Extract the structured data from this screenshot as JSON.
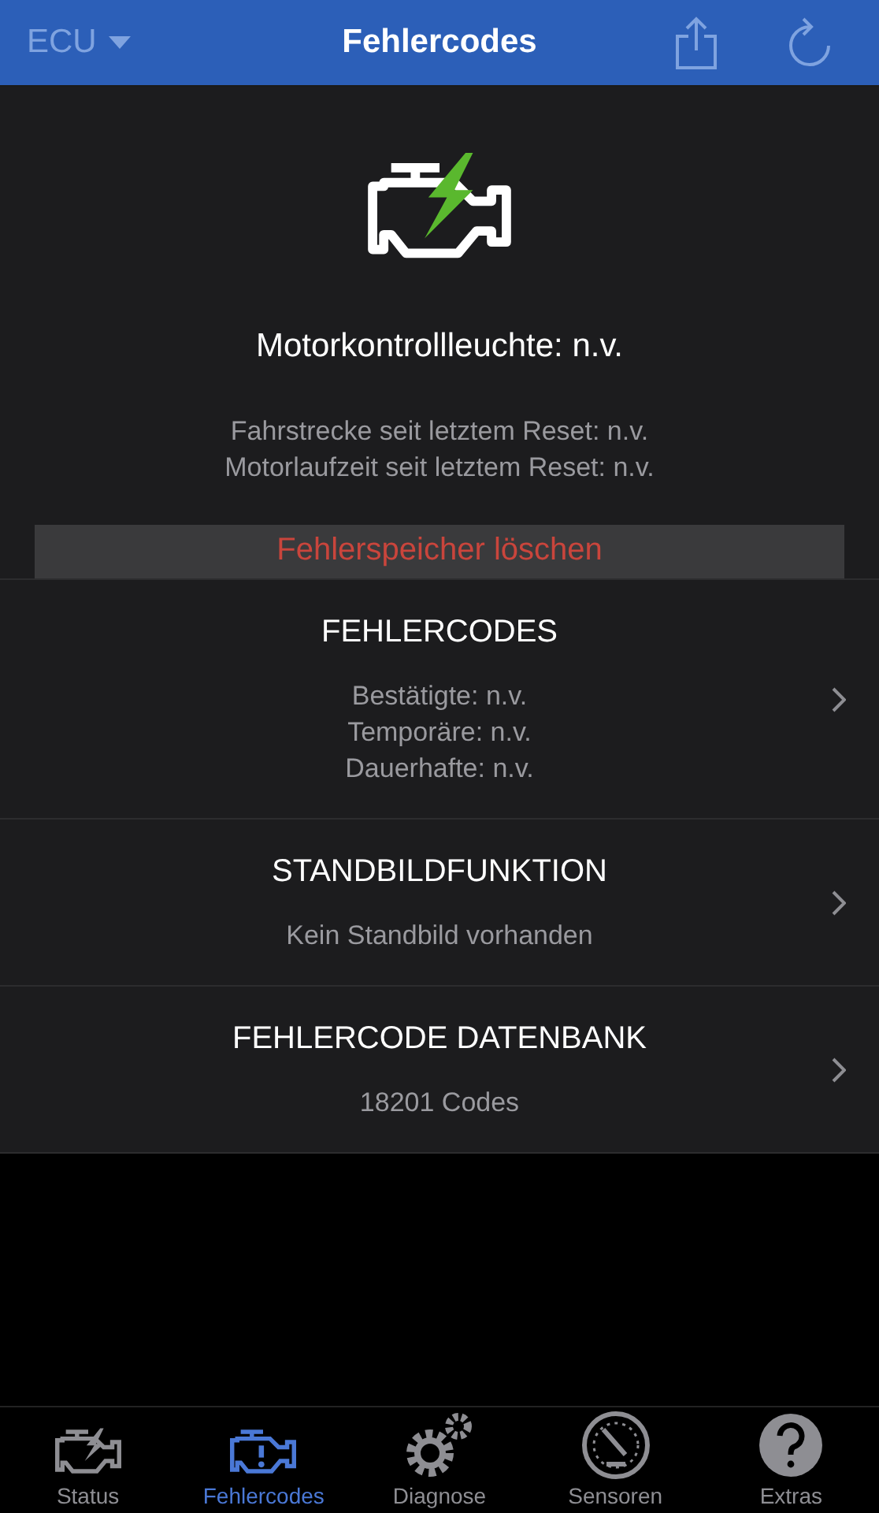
{
  "top_bar": {
    "ecu_label": "ECU",
    "title": "Fehlercodes"
  },
  "summary": {
    "lamp_status": "Motorkontrollleuchte: n.v.",
    "details": [
      "Fahrstrecke seit letztem Reset: n.v.",
      "Motorlaufzeit seit letztem Reset: n.v."
    ],
    "clear_button": "Fehlerspeicher löschen"
  },
  "sections": [
    {
      "title": "FEHLERCODES",
      "lines": [
        "Bestätigte: n.v.",
        "Temporäre: n.v.",
        "Dauerhafte: n.v."
      ]
    },
    {
      "title": "STANDBILDFUNKTION",
      "lines": [
        "Kein Standbild vorhanden"
      ]
    },
    {
      "title": "FEHLERCODE DATENBANK",
      "lines": [
        "18201 Codes"
      ]
    }
  ],
  "tab_bar": [
    {
      "kind": "status",
      "label": "Status",
      "selected": false
    },
    {
      "kind": "codes",
      "label": "Fehlercodes",
      "selected": true
    },
    {
      "kind": "diagnose",
      "label": "Diagnose",
      "selected": false
    },
    {
      "kind": "sensors",
      "label": "Sensoren",
      "selected": false
    },
    {
      "kind": "extras",
      "label": "Extras",
      "selected": false
    }
  ]
}
